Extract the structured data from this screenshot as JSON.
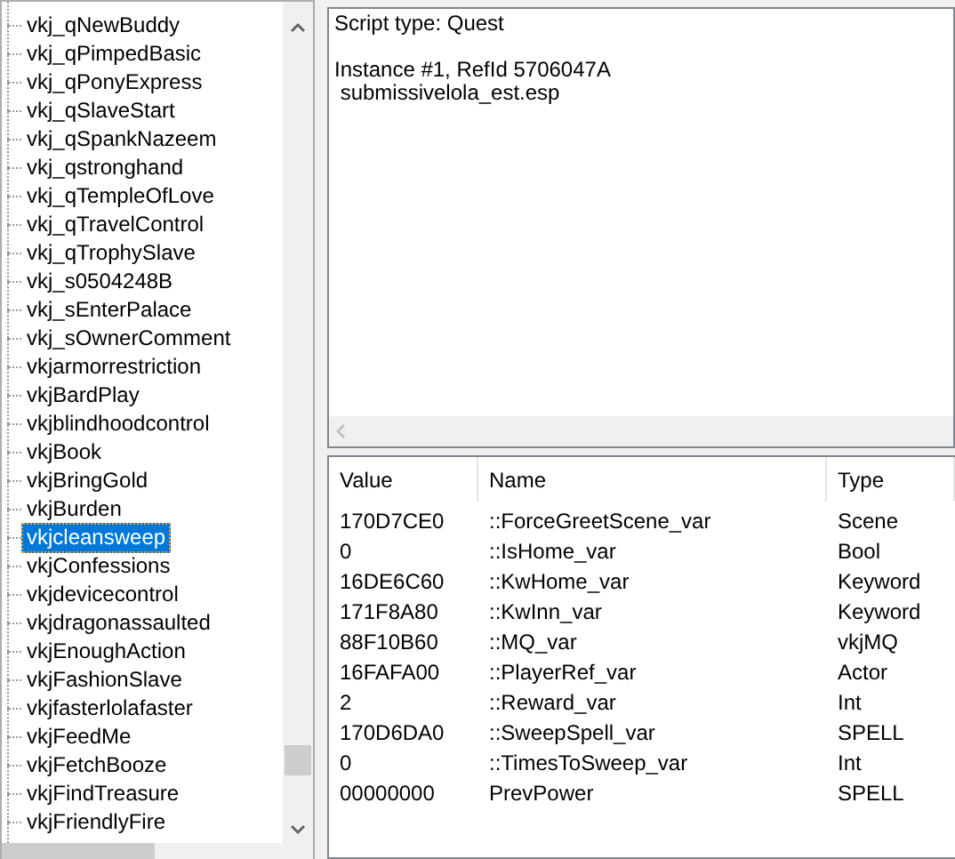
{
  "tree": {
    "items": [
      {
        "label": "vkj_qNewBuddy",
        "selected": false
      },
      {
        "label": "vkj_qPimpedBasic",
        "selected": false
      },
      {
        "label": "vkj_qPonyExpress",
        "selected": false
      },
      {
        "label": "vkj_qSlaveStart",
        "selected": false
      },
      {
        "label": "vkj_qSpankNazeem",
        "selected": false
      },
      {
        "label": "vkj_qstronghand",
        "selected": false
      },
      {
        "label": "vkj_qTempleOfLove",
        "selected": false
      },
      {
        "label": "vkj_qTravelControl",
        "selected": false
      },
      {
        "label": "vkj_qTrophySlave",
        "selected": false
      },
      {
        "label": "vkj_s0504248B",
        "selected": false
      },
      {
        "label": "vkj_sEnterPalace",
        "selected": false
      },
      {
        "label": "vkj_sOwnerComment",
        "selected": false
      },
      {
        "label": "vkjarmorrestriction",
        "selected": false
      },
      {
        "label": "vkjBardPlay",
        "selected": false
      },
      {
        "label": "vkjblindhoodcontrol",
        "selected": false
      },
      {
        "label": "vkjBook",
        "selected": false
      },
      {
        "label": "vkjBringGold",
        "selected": false
      },
      {
        "label": "vkjBurden",
        "selected": false
      },
      {
        "label": "vkjcleansweep",
        "selected": true
      },
      {
        "label": "vkjConfessions",
        "selected": false
      },
      {
        "label": "vkjdevicecontrol",
        "selected": false
      },
      {
        "label": "vkjdragonassaulted",
        "selected": false
      },
      {
        "label": "vkjEnoughAction",
        "selected": false
      },
      {
        "label": "vkjFashionSlave",
        "selected": false
      },
      {
        "label": "vkjfasterlolafaster",
        "selected": false
      },
      {
        "label": "vkjFeedMe",
        "selected": false
      },
      {
        "label": "vkjFetchBooze",
        "selected": false
      },
      {
        "label": "vkjFindTreasure",
        "selected": false
      },
      {
        "label": "vkjFriendlyFire",
        "selected": false
      }
    ]
  },
  "details": {
    "script_type": "Script type: Quest",
    "instance": "Instance #1, RefId 5706047A",
    "file": " submissivelola_est.esp"
  },
  "variables": {
    "columns": [
      "Value",
      "Name",
      "Type"
    ],
    "rows": [
      [
        "170D7CE0",
        "::ForceGreetScene_var",
        "Scene"
      ],
      [
        "0",
        "::IsHome_var",
        "Bool"
      ],
      [
        "16DE6C60",
        "::KwHome_var",
        "Keyword"
      ],
      [
        "171F8A80",
        "::KwInn_var",
        "Keyword"
      ],
      [
        "88F10B60",
        "::MQ_var",
        "vkjMQ"
      ],
      [
        "16FAFA00",
        "::PlayerRef_var",
        "Actor"
      ],
      [
        "2",
        "::Reward_var",
        "Int"
      ],
      [
        "170D6DA0",
        "::SweepSpell_var",
        "SPELL"
      ],
      [
        "0",
        "::TimesToSweep_var",
        "Int"
      ],
      [
        "00000000",
        "PrevPower",
        "SPELL"
      ]
    ]
  }
}
